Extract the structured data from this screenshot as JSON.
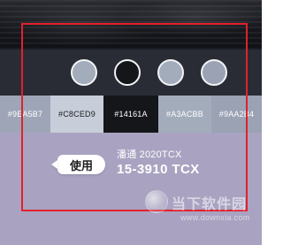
{
  "colors": {
    "accent_frame": "#E3202B",
    "panel_bg": "#A9A3C1",
    "selector_band": "#2B2F38"
  },
  "circles": [
    {
      "name": "color-circle-1",
      "hex": "#A3ACBB"
    },
    {
      "name": "color-circle-2",
      "hex": "#14161A"
    },
    {
      "name": "color-circle-3",
      "hex": "#A3ACBB"
    },
    {
      "name": "color-circle-4",
      "hex": "#9AA2B4"
    }
  ],
  "swatches": [
    {
      "label": "#9EA5B7",
      "hex": "#9EA5B7",
      "text_hex": "#FFFFFF"
    },
    {
      "label": "#C8CED9",
      "hex": "#C8CED9",
      "text_hex": "#1A1C21"
    },
    {
      "label": "#14161A",
      "hex": "#14161A",
      "text_hex": "#FFFFFF"
    },
    {
      "label": "#A3ACBB",
      "hex": "#A3ACBB",
      "text_hex": "#FFFFFF"
    },
    {
      "label": "#9AA2B4",
      "hex": "#9AA2B4",
      "text_hex": "#FFFFFF"
    }
  ],
  "action": {
    "use_label": "使用"
  },
  "pantone": {
    "line1": "潘通 2020TCX",
    "line2": "15-3910 TCX"
  },
  "watermark": {
    "title": "当下软件园",
    "url": "www.downxia.com"
  }
}
